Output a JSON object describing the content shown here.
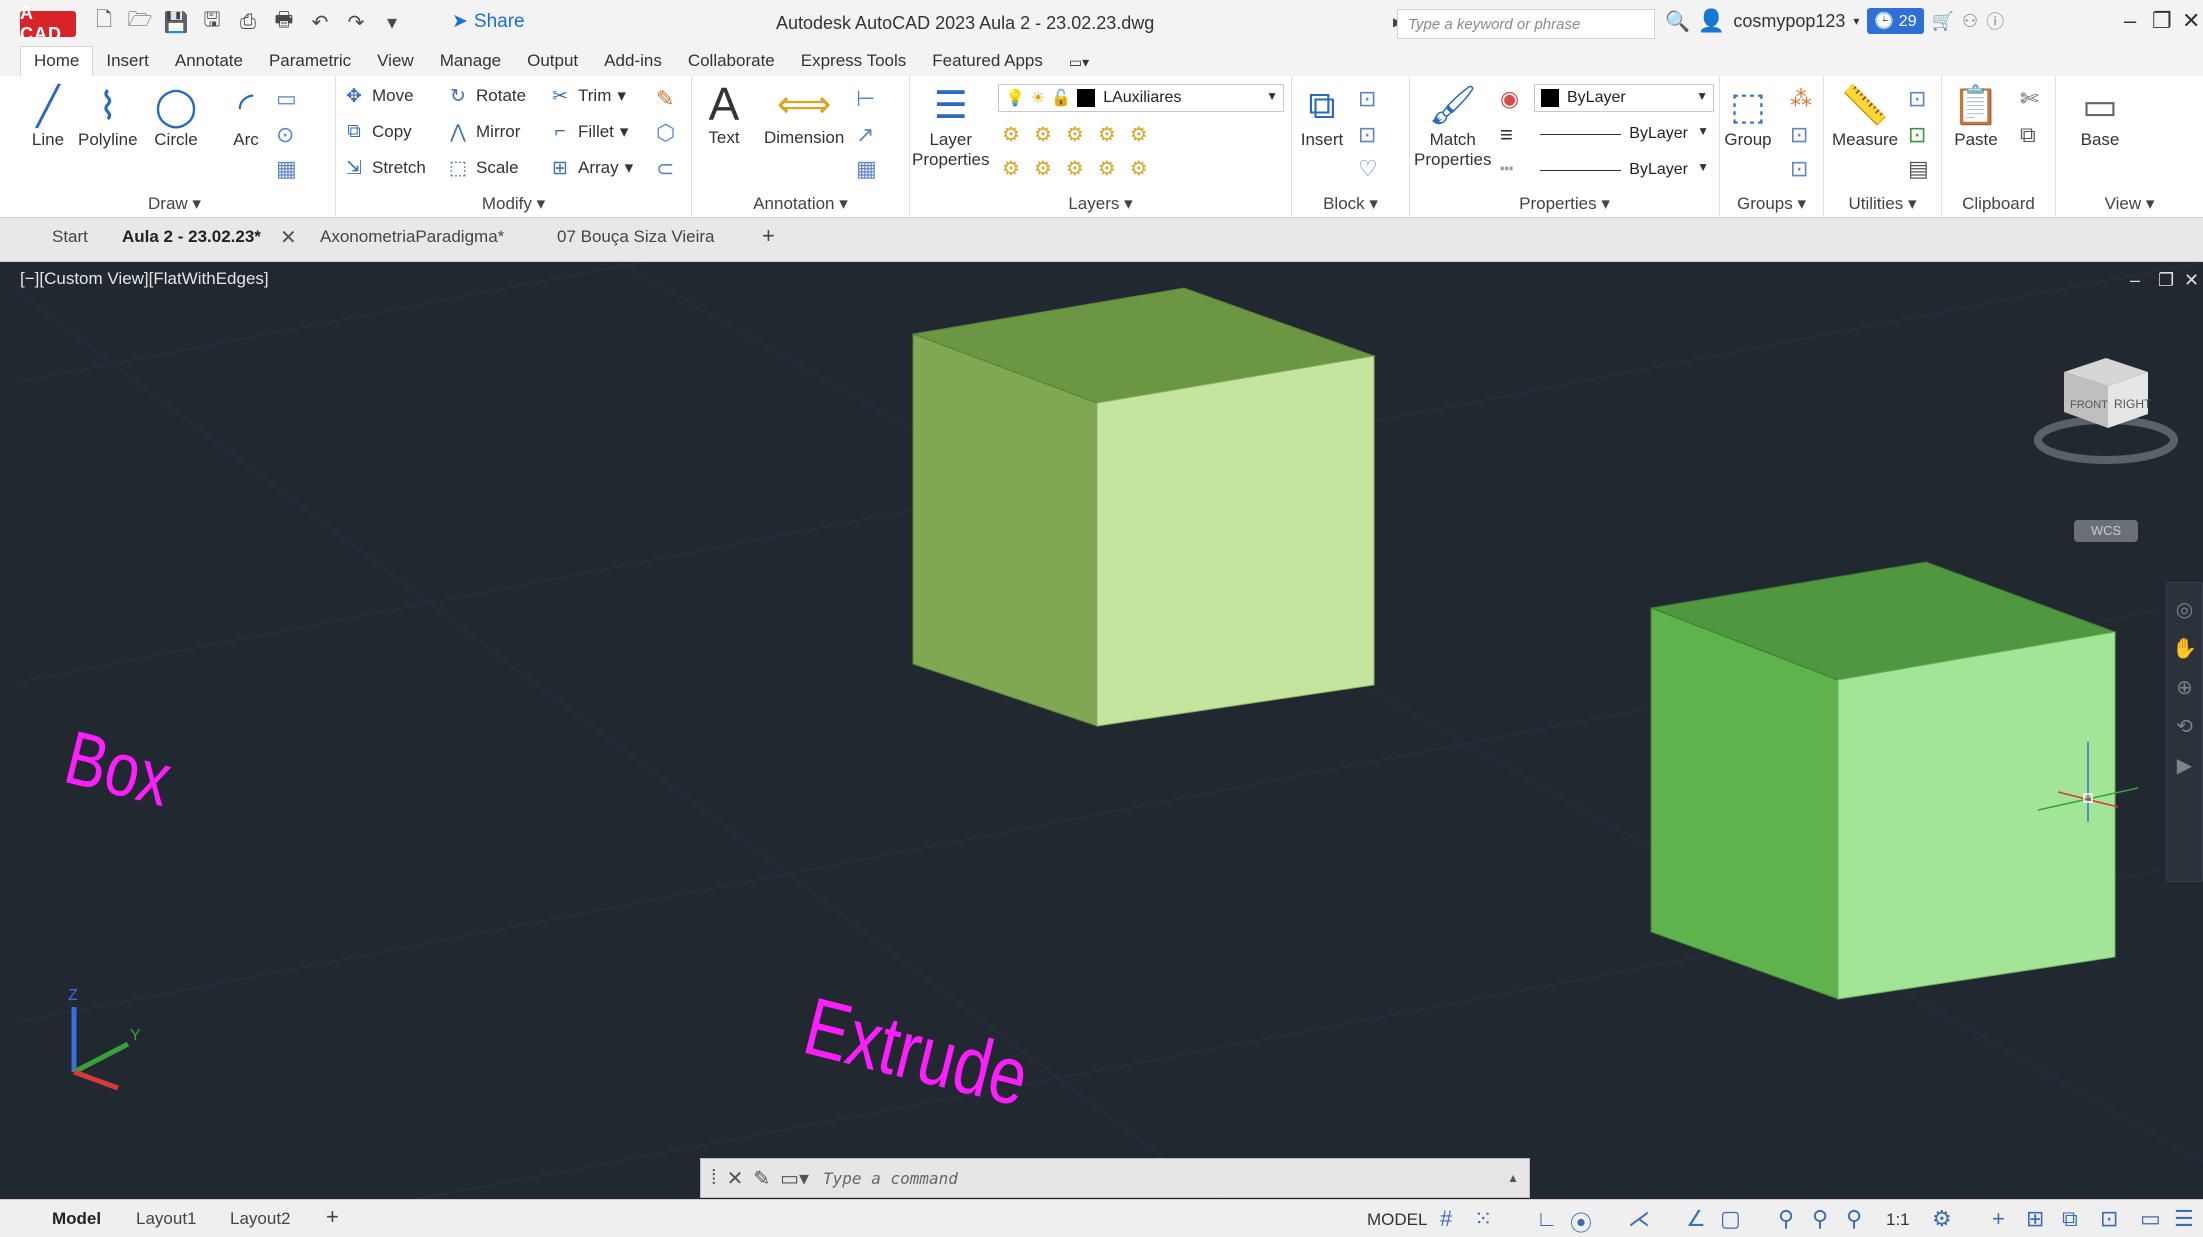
{
  "title_bar": {
    "logo": "A CAD",
    "share_label": "Share",
    "title": "Autodesk AutoCAD 2023   Aula 2 - 23.02.23.dwg",
    "search_placeholder": "Type a keyword or phrase",
    "username": "cosmypop123",
    "notifications_count": "29"
  },
  "ribbon_tabs": [
    "Home",
    "Insert",
    "Annotate",
    "Parametric",
    "View",
    "Manage",
    "Output",
    "Add-ins",
    "Collaborate",
    "Express Tools",
    "Featured Apps"
  ],
  "ribbon": {
    "draw": {
      "title": "Draw",
      "line": "Line",
      "polyline": "Polyline",
      "circle": "Circle",
      "arc": "Arc"
    },
    "modify": {
      "title": "Modify",
      "move": "Move",
      "rotate": "Rotate",
      "trim": "Trim",
      "copy": "Copy",
      "mirror": "Mirror",
      "fillet": "Fillet",
      "stretch": "Stretch",
      "scale": "Scale",
      "array": "Array"
    },
    "annotation": {
      "title": "Annotation",
      "text": "Text",
      "dimension": "Dimension"
    },
    "layers": {
      "title": "Layers",
      "layer_properties": "Layer\nProperties",
      "current_layer": "LAuxiliares"
    },
    "block": {
      "title": "Block",
      "insert": "Insert"
    },
    "properties": {
      "title": "Properties",
      "match_properties": "Match\nProperties",
      "color": "ByLayer",
      "linetype": "ByLayer",
      "lineweight": "ByLayer"
    },
    "groups": {
      "title": "Groups",
      "group": "Group"
    },
    "utilities": {
      "title": "Utilities",
      "measure": "Measure"
    },
    "clipboard": {
      "title": "Clipboard",
      "paste": "Paste"
    },
    "view": {
      "title": "View",
      "base": "Base"
    }
  },
  "file_tabs": [
    {
      "label": "Start"
    },
    {
      "label": "Aula 2 - 23.02.23*"
    },
    {
      "label": "AxonometriaParadigma*"
    },
    {
      "label": "07 Bouça Siza Vieira"
    }
  ],
  "viewport": {
    "view_label": "[−][Custom View][FlatWithEdges]",
    "viewcube_face_front": "FRONT",
    "viewcube_face_right": "RIGHT",
    "wcs_label": "WCS",
    "text_box": "Box",
    "text_extrude": "Extrude",
    "axis_z": "Z",
    "axis_y": "Y"
  },
  "command_line": {
    "placeholder": "Type a command"
  },
  "status_bar": {
    "layout_tabs": [
      "Model",
      "Layout1",
      "Layout2"
    ],
    "mode": "MODEL",
    "scale": "1:1"
  },
  "colors": {
    "viewport_bg": "#212830",
    "cube1_top": "#6b9644",
    "cube1_left": "#7ea852",
    "cube1_right": "#c4e59d",
    "cube2_top": "#4f983f",
    "cube2_left": "#5fb34d",
    "cube2_right": "#a3e597",
    "magenta_text": "#ff1eff",
    "accent_blue": "#2f6fd8"
  }
}
